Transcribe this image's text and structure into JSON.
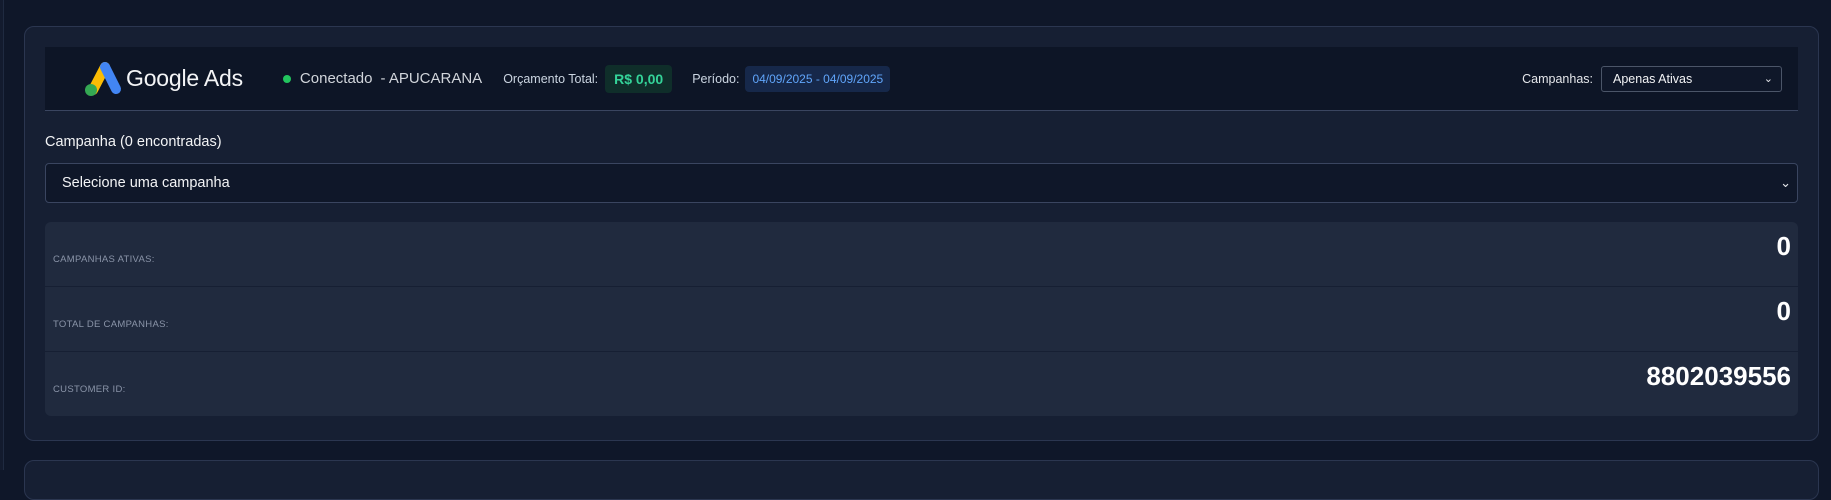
{
  "header": {
    "logo_text": "Google Ads",
    "status_label": "Conectado",
    "account_name": "- APUCARANA",
    "budget_label": "Orçamento Total:",
    "budget_value": "R$ 0,00",
    "period_label": "Período:",
    "period_value": "04/09/2025 - 04/09/2025",
    "campaigns_filter_label": "Campanhas:",
    "campaigns_filter_value": "Apenas Ativas"
  },
  "campaign": {
    "section_label": "Campanha (0 encontradas)",
    "select_placeholder": "Selecione uma campanha"
  },
  "stats": [
    {
      "label": "CAMPANHAS ATIVAS:",
      "value": "0"
    },
    {
      "label": "TOTAL DE CAMPANHAS:",
      "value": "0"
    },
    {
      "label": "CUSTOMER ID:",
      "value": "8802039556"
    }
  ],
  "colors": {
    "background": "#0f1729",
    "card": "#161f33",
    "status_dot": "#22c55e",
    "budget_text": "#34d399",
    "period_text": "#60a5fa"
  },
  "icons": [
    "google-ads-logo-icon",
    "status-dot-icon",
    "chevron-down-icon"
  ]
}
